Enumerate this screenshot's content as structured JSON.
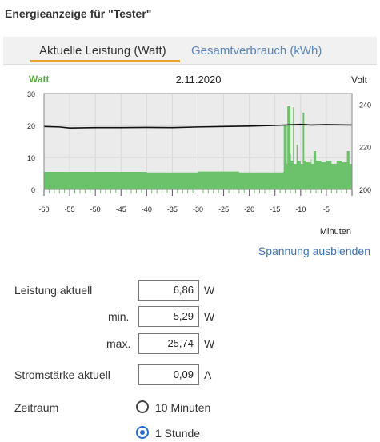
{
  "title": "Energieanzeige für \"Tester\"",
  "tabs": [
    {
      "label": "Aktuelle Leistung (Watt)",
      "active": true
    },
    {
      "label": "Gesamtverbrauch (kWh)",
      "active": false
    }
  ],
  "chart_data": {
    "type": "area",
    "title": "2.11.2020",
    "left_axis_label": "Watt",
    "right_axis_label": "Volt",
    "xlabel": "Minuten",
    "x_range": [
      -60,
      0
    ],
    "x_ticks": [
      -60,
      -55,
      -50,
      -45,
      -40,
      -35,
      -30,
      -25,
      -20,
      -15,
      -10,
      -5
    ],
    "y_range": [
      0,
      30
    ],
    "y_ticks": [
      0,
      10,
      20,
      30
    ],
    "y2_range": [
      200,
      245
    ],
    "y2_ticks": [
      200,
      220,
      240
    ],
    "grid": true,
    "series": [
      {
        "name": "Watt",
        "color": "#6cc26a",
        "x": [
          -60,
          -40,
          -30,
          -22,
          -13.4,
          -13.3,
          -12.7,
          -12.6,
          -12.0,
          -11.9,
          -11.5,
          -11.3,
          -10.8,
          -10.6,
          -10.0,
          -9.6,
          -9.3,
          -9.0,
          -8.0,
          -7.9,
          -7.5,
          -7.0,
          -6.0,
          -5.0,
          -4.0,
          -3.0,
          -2.0,
          -1.0,
          -0.5,
          0
        ],
        "y": [
          5.5,
          5.3,
          5.6,
          5.3,
          5.5,
          20.0,
          8.0,
          26.0,
          11.0,
          9.0,
          25.7,
          8.0,
          14.0,
          9.0,
          8.0,
          24.0,
          9.0,
          8.5,
          9.5,
          8.0,
          12.0,
          9.0,
          8.5,
          9.0,
          8.0,
          9.0,
          8.5,
          12.0,
          8.0,
          7.5
        ]
      },
      {
        "name": "Volt",
        "color": "#111111",
        "x": [
          -60,
          -57,
          -55,
          -50,
          -45,
          -40,
          -35,
          -30,
          -25,
          -20,
          -15,
          -12,
          -10,
          -8,
          -5,
          -3,
          0
        ],
        "y": [
          229.5,
          229.3,
          228.8,
          229.0,
          229.0,
          229.1,
          229.0,
          229.3,
          229.5,
          229.7,
          230.0,
          230.3,
          230.5,
          230.2,
          230.4,
          230.3,
          230.2
        ]
      }
    ]
  },
  "toggle_voltage_label": "Spannung ausblenden",
  "form": {
    "power_current": {
      "label": "Leistung aktuell",
      "value": "6,86",
      "unit": "W"
    },
    "power_min": {
      "label": "min.",
      "value": "5,29",
      "unit": "W"
    },
    "power_max": {
      "label": "max.",
      "value": "25,74",
      "unit": "W"
    },
    "current": {
      "label": "Stromstärke aktuell",
      "value": "0,09",
      "unit": "A"
    },
    "period": {
      "label": "Zeitraum",
      "options": [
        {
          "label": "10 Minuten",
          "checked": false
        },
        {
          "label": "1 Stunde",
          "checked": true
        }
      ]
    }
  }
}
